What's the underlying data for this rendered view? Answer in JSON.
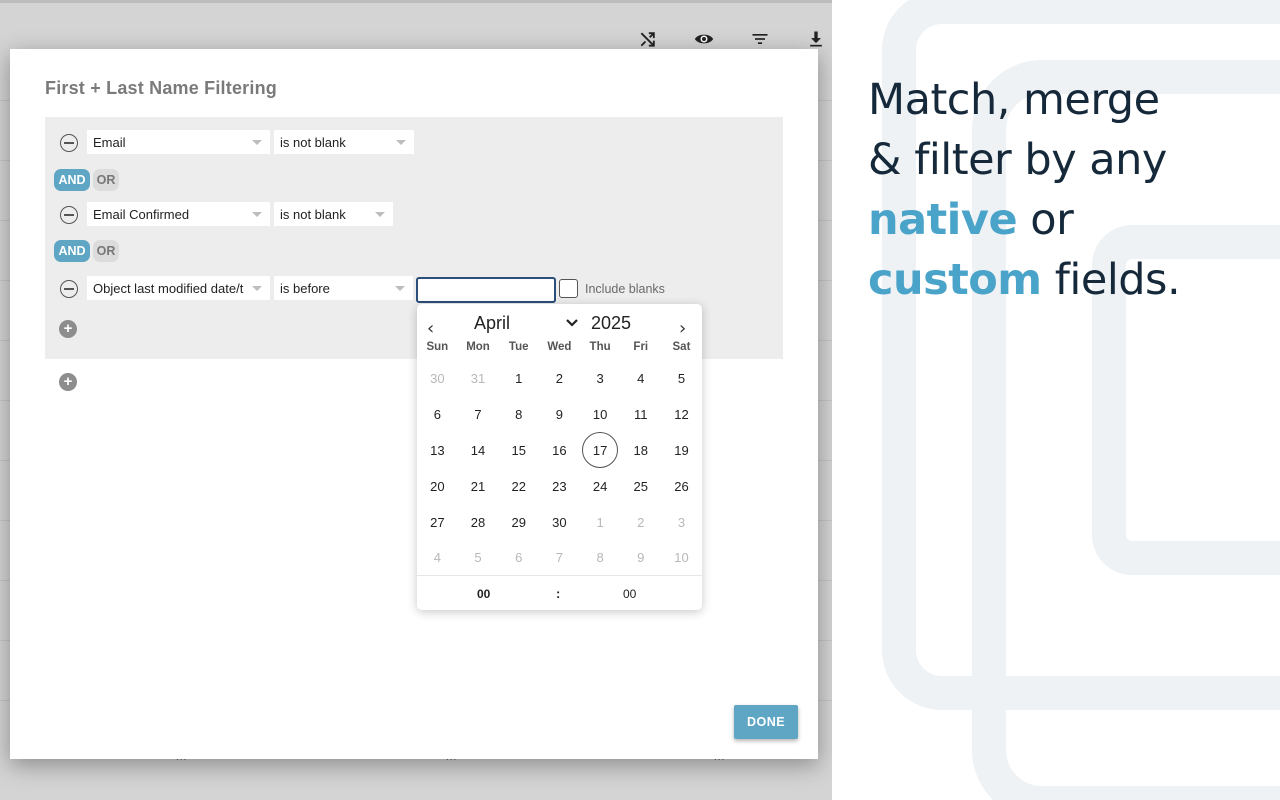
{
  "toolbar": {
    "icons": [
      "shuffle-icon",
      "eye-icon",
      "filter-icon",
      "download-icon"
    ]
  },
  "modal": {
    "title": "First + Last Name Filtering",
    "conditions": [
      {
        "field": "Email",
        "operator": "is not blank"
      },
      {
        "field": "Email Confirmed",
        "operator": "is not blank"
      },
      {
        "field": "Object last modified date/t",
        "operator": "is before",
        "value": ""
      }
    ],
    "logic_and": "AND",
    "logic_or": "OR",
    "include_blanks_label": "Include blanks",
    "add_icon": "+",
    "done_label": "DONE"
  },
  "calendar": {
    "month": "April",
    "year": "2025",
    "weekdays": [
      "Sun",
      "Mon",
      "Tue",
      "Wed",
      "Thu",
      "Fri",
      "Sat"
    ],
    "days": [
      "30",
      "31",
      "1",
      "2",
      "3",
      "4",
      "5",
      "6",
      "7",
      "8",
      "9",
      "10",
      "11",
      "12",
      "13",
      "14",
      "15",
      "16",
      "17",
      "18",
      "19",
      "20",
      "21",
      "22",
      "23",
      "24",
      "25",
      "26",
      "27",
      "28",
      "29",
      "30",
      "1",
      "2",
      "3",
      "4",
      "5",
      "6",
      "7",
      "8",
      "9",
      "10"
    ],
    "today": "17",
    "hour": "00",
    "separator": ":",
    "minute": "00"
  },
  "dots": [
    "...",
    "...",
    "..."
  ],
  "promo": {
    "line1": "Match, merge",
    "line2": "& filter by any",
    "line3_accent": "native",
    "line3_rest": " or",
    "line4_accent": "custom",
    "line4_rest": " fields."
  },
  "colors": {
    "accent": "#4aa3c8",
    "button": "#5fa6c4",
    "heading": "#15293a"
  }
}
